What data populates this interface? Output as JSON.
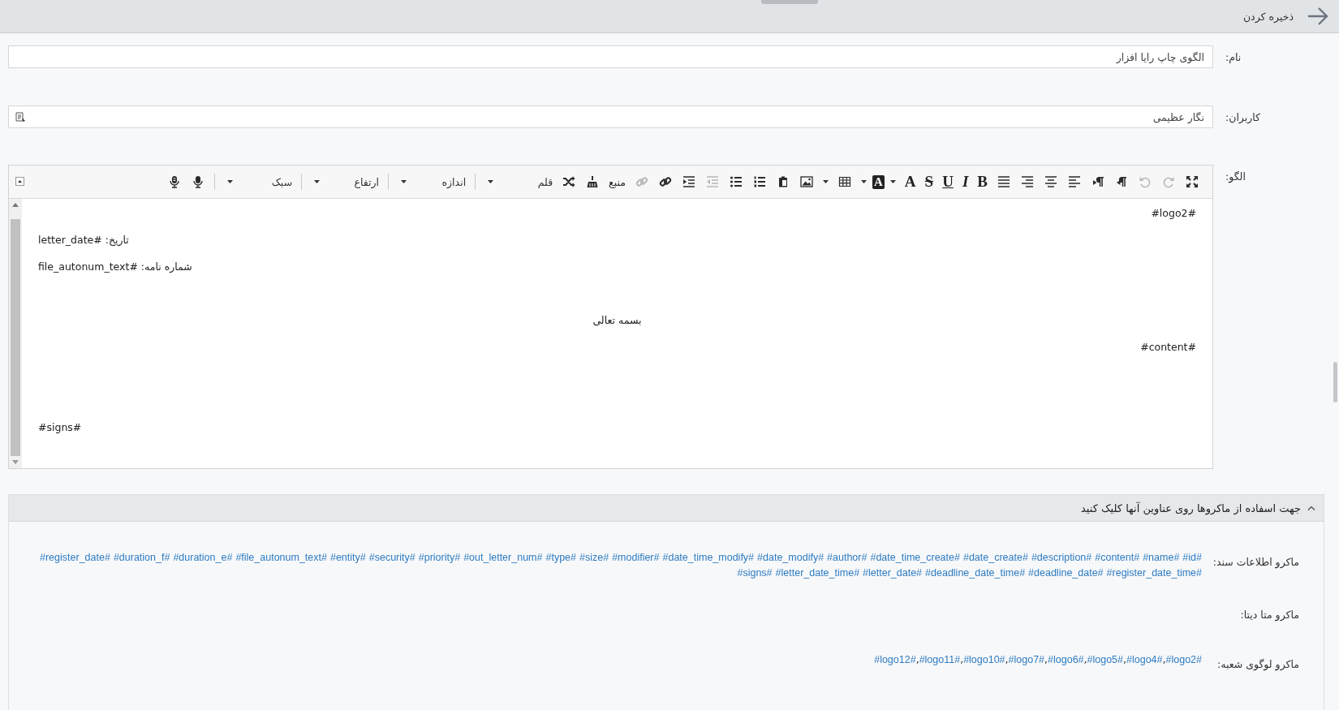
{
  "header": {
    "save_label": "ذخیره کردن"
  },
  "fields": [
    {
      "label": "نام:",
      "value": "الگوی چاپ رایا افزار",
      "kind": "text"
    },
    {
      "label": "کاربران:",
      "value": "نگار عظیمی",
      "kind": "picker"
    }
  ],
  "editor": {
    "label": "الگو:",
    "toolbar": [
      {
        "kind": "fullscreen",
        "disabled": false
      },
      {
        "kind": "redo",
        "disabled": true
      },
      {
        "kind": "undo",
        "disabled": true
      },
      {
        "kind": "rtl",
        "disabled": false
      },
      {
        "kind": "ltr",
        "disabled": false
      },
      {
        "kind": "alignleft",
        "disabled": false
      },
      {
        "kind": "aligncenter",
        "disabled": false
      },
      {
        "kind": "alignright",
        "disabled": false
      },
      {
        "kind": "justify",
        "disabled": false
      },
      {
        "kind": "bold",
        "glyph": "B",
        "disabled": false
      },
      {
        "kind": "italic",
        "glyph": "I",
        "disabled": false
      },
      {
        "kind": "underline",
        "glyph": "U",
        "disabled": false
      },
      {
        "kind": "strike",
        "glyph": "S",
        "disabled": false
      },
      {
        "kind": "textcolor",
        "glyph": "A",
        "disabled": false,
        "has_menu": true
      },
      {
        "kind": "bgcolor",
        "glyph": "A",
        "disabled": false,
        "has_menu": true
      },
      {
        "kind": "table",
        "disabled": false,
        "has_menu": true
      },
      {
        "kind": "image",
        "disabled": false
      },
      {
        "kind": "paste",
        "disabled": false
      },
      {
        "kind": "numbered",
        "disabled": false
      },
      {
        "kind": "bullets",
        "disabled": false
      },
      {
        "kind": "outdent",
        "disabled": true
      },
      {
        "kind": "indent",
        "disabled": false
      },
      {
        "kind": "link",
        "disabled": false
      },
      {
        "kind": "unlink",
        "disabled": true
      },
      {
        "kind": "source",
        "label": "منبع",
        "disabled": false
      },
      {
        "kind": "clean",
        "disabled": false
      },
      {
        "kind": "shuffle",
        "disabled": false
      },
      {
        "kind": "dropdown",
        "label": "قلم"
      },
      {
        "kind": "separator"
      },
      {
        "kind": "dropdown",
        "label": "اندازه"
      },
      {
        "kind": "separator"
      },
      {
        "kind": "dropdown",
        "label": "ارتفاع"
      },
      {
        "kind": "separator"
      },
      {
        "kind": "dropdown",
        "label": "سبک"
      },
      {
        "kind": "separator"
      },
      {
        "kind": "mic",
        "disabled": false
      },
      {
        "kind": "voice",
        "disabled": false
      }
    ],
    "paragraphs": [
      {
        "kind": "right",
        "text": "#logo2#"
      },
      {
        "kind": "left",
        "text": "تاریخ: #letter_date"
      },
      {
        "kind": "left",
        "text": "شماره نامه: #file_autonum_text"
      },
      {
        "kind": "empty"
      },
      {
        "kind": "center",
        "text": "بسمه تعالی"
      },
      {
        "kind": "right",
        "text": "#content#"
      },
      {
        "kind": "empty"
      },
      {
        "kind": "empty"
      },
      {
        "kind": "left",
        "text": "#signs#"
      }
    ]
  },
  "macros": {
    "title": "جهت اسفاده از ماکروها روی عناوین آنها کلیک کنید",
    "expanded": true,
    "rows": [
      {
        "label": "ماکرو اطلاعات سند:",
        "macros": [
          "#id#",
          "#name#",
          "#content#",
          "#description#",
          "#date_create#",
          "#date_time_create#",
          "#author#",
          "#date_modify#",
          "#date_time_modify#",
          "#modifier#",
          "#size#",
          "#type#",
          "#out_letter_num#",
          "#priority#",
          "#security#",
          "#entity#",
          "#file_autonum_text#",
          "#duration_e#",
          "#duration_f#",
          "#register_date#",
          "#register_date_time#",
          "#deadline_date#",
          "#deadline_date_time#",
          "#letter_date#",
          "#letter_date_time#",
          "#signs#"
        ]
      },
      {
        "label": "ماکرو متا دیتا:"
      },
      {
        "label": "ماکرو لوگوی شعبه:",
        "separator": ",",
        "macros": [
          "#logo2#",
          "#logo4#",
          "#logo5#",
          "#logo6#",
          "#logo7#",
          "#logo10#",
          "#logo11#",
          "#logo12#"
        ]
      }
    ]
  }
}
